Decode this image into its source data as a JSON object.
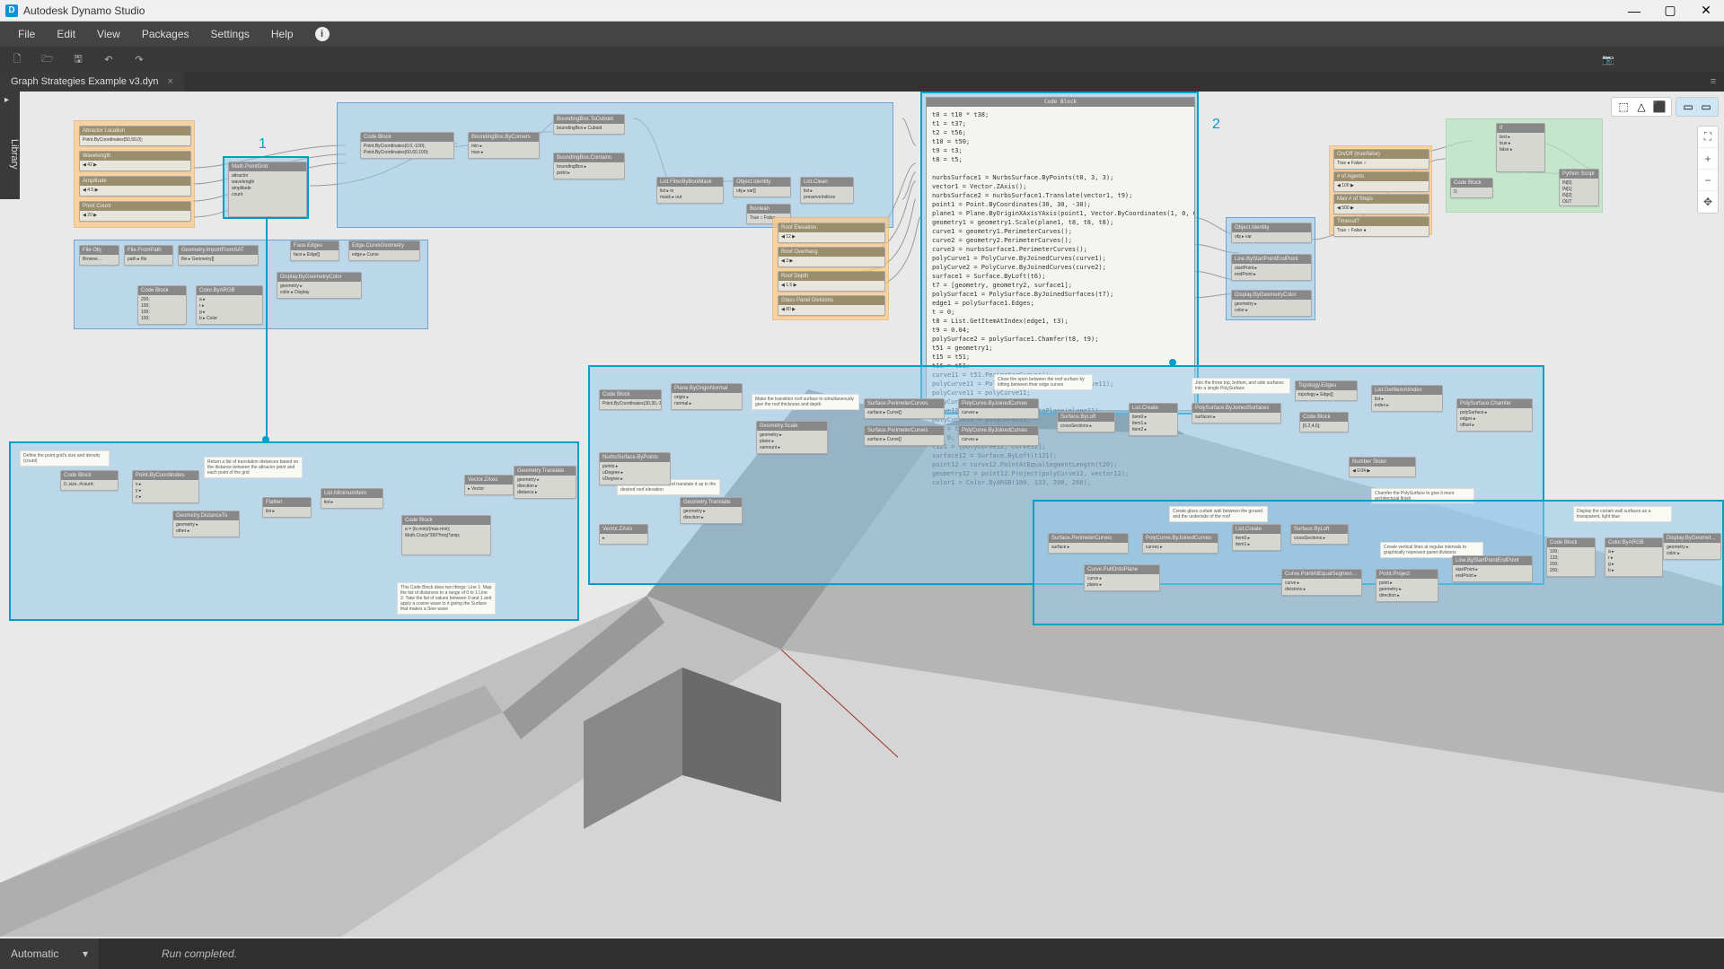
{
  "window": {
    "title": "Autodesk Dynamo Studio",
    "logo_letter": "D",
    "minimize": "—",
    "maximize": "▢",
    "close": "✕"
  },
  "menu": {
    "file": "File",
    "edit": "Edit",
    "view": "View",
    "packages": "Packages",
    "settings": "Settings",
    "help": "Help",
    "info": "i"
  },
  "toolbar": {
    "new": "🗋",
    "open": "🗁",
    "save": "🖫",
    "undo": "↶",
    "redo": "↷",
    "camera": "📷"
  },
  "tab": {
    "name": "Graph Strategies Example v3.dyn",
    "close": "×"
  },
  "library": {
    "label": "Library",
    "arrow": "▸"
  },
  "viewcontrols": {
    "icons": [
      "⬚",
      "△",
      "⬛"
    ],
    "toggle_a": "▭",
    "toggle_b": "▭"
  },
  "nav": {
    "fit": "⛶",
    "zoom_in": "+",
    "zoom_out": "−",
    "pan": "✥"
  },
  "callouts": {
    "one": "1",
    "two": "2"
  },
  "groups": {
    "attractor_location": "Attractor Location",
    "wavelength": "Wavelength",
    "amplitude": "Amplitude",
    "point_count": "Point Count",
    "code_block": "Code Block",
    "bbox_bycorners": "BoundingBox.ByCorners",
    "bbox_tocuboid": "BoundingBox.ToCuboid",
    "list_filter": "List.FilterByBoolMask",
    "obj_identity": "Object.Identity",
    "list_clean": "List.Clean",
    "boolean": "Boolean",
    "roof_elevation": "Roof Elevation",
    "roof_overhang": "Roof Overhang",
    "roof_depth": "Roof Depth",
    "glass_panel": "Glass Panel Divisions",
    "obj_identity2": "Object.Identity",
    "linework": "Line.ByStartPointEndPoint",
    "display_color": "Display.ByGeometryColor",
    "onoff": "On/Off (true/false)",
    "agents": "# of Agents",
    "steps": "Max # of Steps",
    "timeout": "Timeout?",
    "python": "Python Script",
    "if": "If",
    "file_obj": "File Obj",
    "file_path": "File.FromPath",
    "geom_import": "Geometry.ImportFromSAT",
    "face_edges": "Face.Edges",
    "edge_curve": "Edge.CurveGeometry",
    "display_bygeom": "Display.ByGeometryColor",
    "color_byargb": "Color.ByARGB",
    "code_block2": "Code Block",
    "math_pointgrid": "Math.PointGrid"
  },
  "big_code_block": {
    "title": "Code Block",
    "code": "t0 = t10 * t38;\nt1 = t37;\nt2 = t56;\nt10 = t50;\nt9 = t3;\nt8 = t5;\n\nnurbsSurface1 = NurbsSurface.ByPoints(t0, 3, 3);\nvector1 = Vector.ZAxis();\nnurbsSurface2 = nurbsSurface1.Translate(vector1, t9);\npoint1 = Point.ByCoordinates(30, 30, -30);\nplane1 = Plane.ByOriginXAxisYAxis(point1, Vector.ByCoordinates(1, 0, 0), Vector.B\ngeometry1 = geometry1.Scale(plane1, t8, t8, t8);\ncurve1 = geometry1.PerimeterCurves();\ncurve2 = geometry2.PerimeterCurves();\ncurve3 = nurbsSurface1.PerimeterCurves();\npolyCurve1 = PolyCurve.ByJoinedCurves(curve1);\npolyCurve2 = PolyCurve.ByJoinedCurves(curve2);\nsurface1 = Surface.ByLoft(t6);\nt7 = [geometry, geometry2, surface1];\npolySurface1 = PolySurface.ByJoinedSurfaces(t7);\nedge1 = polySurface1.Edges;\nt = 0;\nt8 = List.GetItemAtIndex(edge1, t3);\nt9 = 0.04;\npolySurface2 = polySurface1.Chamfer(t8, t9);\nt51 = geometry1;\nt15 = t51;\nt16 = t51;\ncurve11 = t51.PerimeterCurves();\npolyCurve11 = PolyCurve.ByJoinedCurves(curve11);\npolyCurve11 = polyCurve11;\npolyCurve12 = polyCurve11;\ncurve12 = polyCurve11.PullOntoPlane(plane11);\npolyCurve13 = polyCurve11;\nt18 = t56;\nt = 0;\nt121 = [polyCurve12, curve12];\nsurface12 = Surface.ByLoft(t121);\npoint12 = curve12.PointAtEqualSegmentLength(t20);\ngeometry12 = point12.Project(polyCurve12, vector12);\ncolor1 = Color.ByARGB(100, 133, 200, 200);"
  },
  "detail_1": {
    "note1": "Define the point grid's size and density (count)",
    "note2": "Return a list of translation distances based on the distance between the attractor point and each point of the grid",
    "note3": "This Code Block does two things:\nLine 1: Map the list of distances to a range of 0 to 1\nLine 2: Take the list of values between 0 and 1 and apply a cosine wave to it giving the Surface that makes a Sine wave"
  },
  "detail_2": {
    "note1": "Close the open between the roof surface by lofting between their edge curves",
    "note2": "Join the three top, bottom, and side surfaces into a single PolySurface",
    "note3": "Make the transition roof surface to simultaneously give the roof thickness and depth",
    "note4": "Create a NurbsSurface and translate it up to the desired roof elevation",
    "note5": "Chamfer the PolySurface to give it more architectural finish"
  },
  "detail_3": {
    "note1": "Create glass curtain wall between the ground and the underside of the roof",
    "note2": "Display the curtain wall surfaces as a transparent, light blue",
    "note3": "Create vertical lines at regular intervals to graphically represent panel divisions"
  },
  "status": {
    "run_mode": "Automatic",
    "run_mode_arrow": "▾",
    "run_status": "Run completed."
  }
}
